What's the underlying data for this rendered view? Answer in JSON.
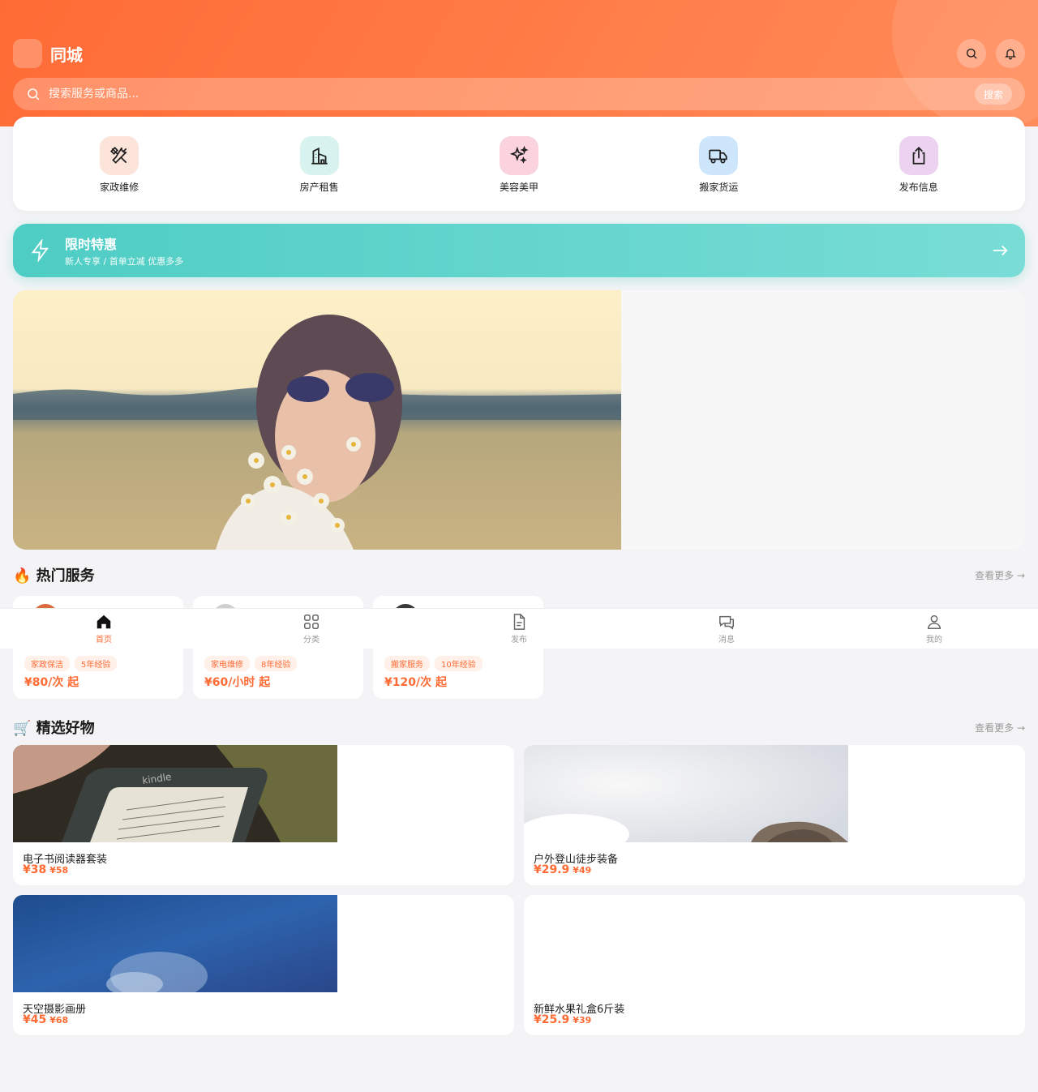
{
  "header": {
    "brand_icon": "",
    "brand_name": "同城",
    "search_placeholder": "搜索服务或商品...",
    "search_button": "搜索"
  },
  "categories": [
    {
      "label": "家政维修",
      "icon": "tools-icon",
      "bg": "#fde4da"
    },
    {
      "label": "房产租售",
      "icon": "building-icon",
      "bg": "#d8f3ef"
    },
    {
      "label": "美容美甲",
      "icon": "sparkles-icon",
      "bg": "#fbd3de"
    },
    {
      "label": "搬家货运",
      "icon": "truck-icon",
      "bg": "#cde6fb"
    },
    {
      "label": "发布信息",
      "icon": "share-icon",
      "bg": "#ecd3ef"
    }
  ],
  "promo": {
    "title": "限时特惠",
    "subtitle": "新人专享 / 首单立减 优惠多多"
  },
  "hot_services": {
    "title": "🔥 热门服务",
    "more": "查看更多 →",
    "items": [
      {
        "tag1": "家政保洁",
        "tag2": "5年经验",
        "price": "¥80/次 起"
      },
      {
        "tag1": "家电维修",
        "tag2": "8年经验",
        "price": "¥60/小时 起"
      },
      {
        "tag1": "搬家服务",
        "tag2": "10年经验",
        "price": "¥120/次 起"
      }
    ]
  },
  "tabbar": [
    {
      "label": "首页",
      "icon": "home-icon",
      "active": true
    },
    {
      "label": "分类",
      "icon": "grid-icon",
      "active": false
    },
    {
      "label": "发布",
      "icon": "document-icon",
      "active": false
    },
    {
      "label": "消息",
      "icon": "chat-icon",
      "active": false
    },
    {
      "label": "我的",
      "icon": "user-icon",
      "active": false
    }
  ],
  "products": {
    "title": "🛒 精选好物",
    "more": "查看更多 →",
    "items": [
      {
        "name": "电子书阅读器套装",
        "price": "¥38",
        "old_price": "¥58"
      },
      {
        "name": "户外登山徒步装备",
        "price": "¥29.9",
        "old_price": "¥49"
      },
      {
        "name": "天空摄影画册",
        "price": "¥45",
        "old_price": "¥68"
      },
      {
        "name": "新鲜水果礼盒6斤装",
        "price": "¥25.9",
        "old_price": "¥39"
      }
    ]
  },
  "colors": {
    "accent": "#ff6b35",
    "teal": "#4ecdc4"
  }
}
